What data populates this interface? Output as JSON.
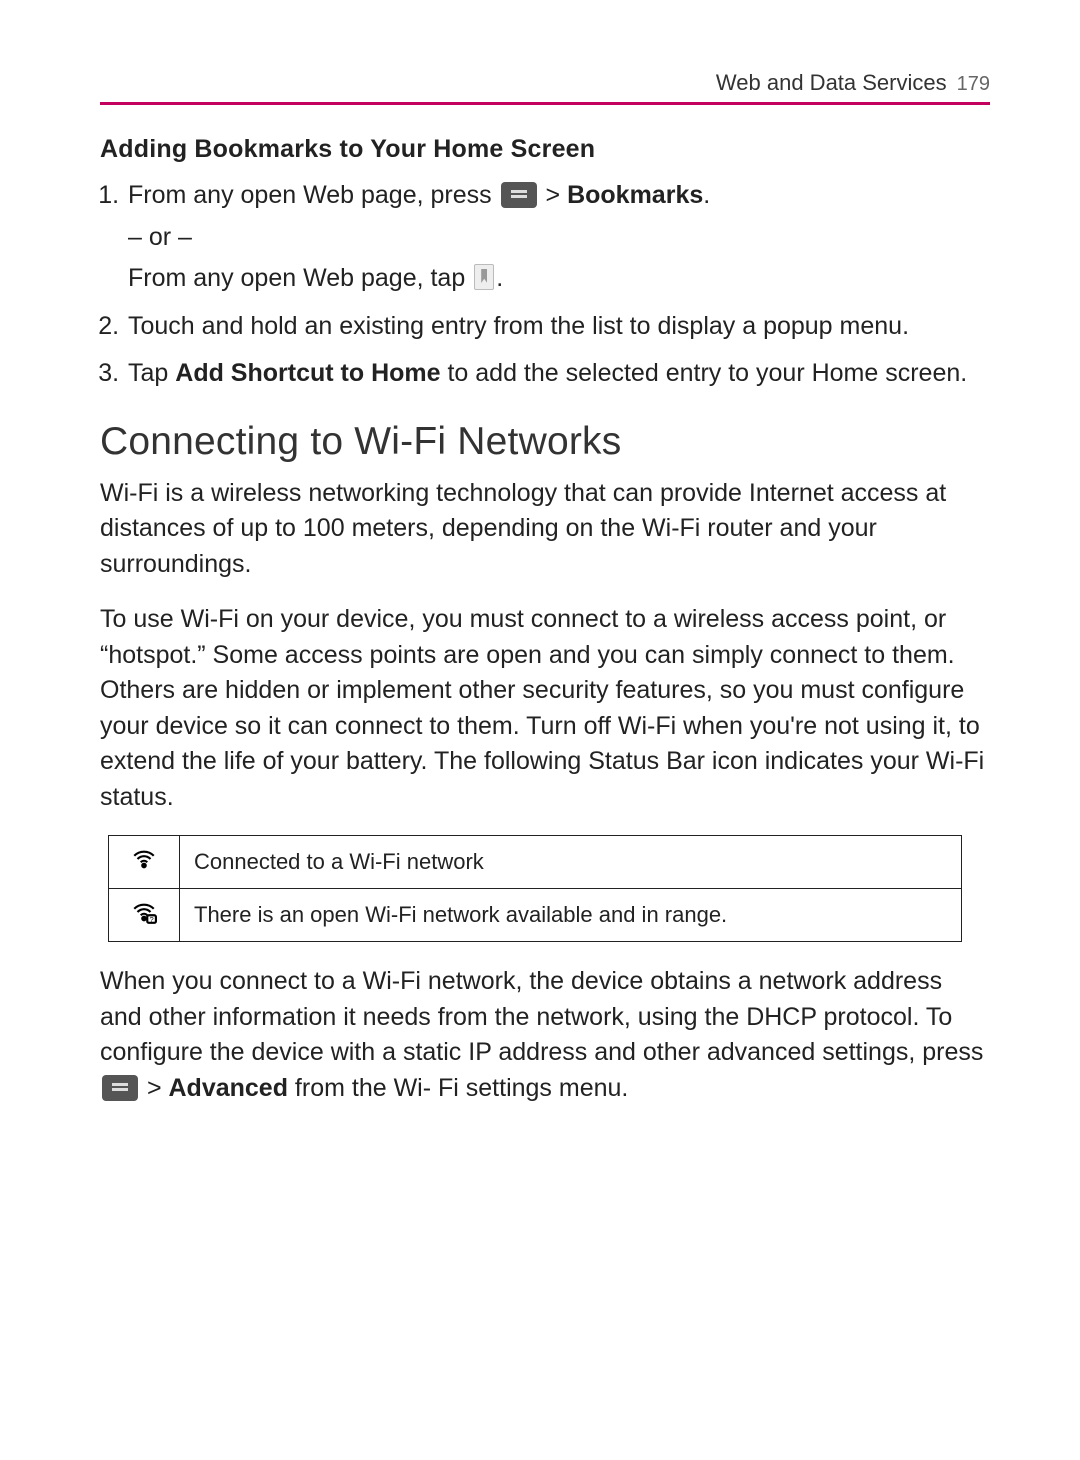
{
  "header": {
    "section": "Web and Data Services",
    "page_number": "179"
  },
  "bookmarks": {
    "heading": "Adding Bookmarks to Your Home Screen",
    "step1_pre": "From any open Web page, press ",
    "step1_gt": " > ",
    "step1_bold": "Bookmarks",
    "step1_end": ".",
    "or": "– or –",
    "step1b_pre": "From any open Web page, tap ",
    "step1b_end": ".",
    "step2": "Touch and hold an existing entry from the list to display a popup menu.",
    "step3_pre": "Tap ",
    "step3_bold": "Add Shortcut to Home",
    "step3_end": " to add the selected entry to your Home screen."
  },
  "wifi": {
    "heading": "Connecting to Wi-Fi Networks",
    "p1": "Wi-Fi is a wireless networking technology that can provide Internet access at distances of up to 100 meters, depending on the Wi-Fi router and your surroundings.",
    "p2": "To use Wi-Fi on your device, you must connect to a wireless access point, or “hotspot.” Some access points are open and you can simply connect to them. Others are hidden or implement other security features, so you must configure your device so it can connect to them. Turn off Wi-Fi when you're not using it, to extend the life of your battery. The following Status Bar icon indicates your Wi-Fi status.",
    "table": {
      "row1": "Connected to a Wi-Fi network",
      "row2": "There is an open Wi-Fi network available and in range."
    },
    "p3_pre": "When you connect to a Wi-Fi network, the device obtains a network address and other information it needs from the network, using the DHCP protocol. To configure the device with a static IP address and other advanced settings, press ",
    "p3_gt": " > ",
    "p3_bold": "Advanced",
    "p3_end": " from the Wi- Fi settings menu."
  }
}
